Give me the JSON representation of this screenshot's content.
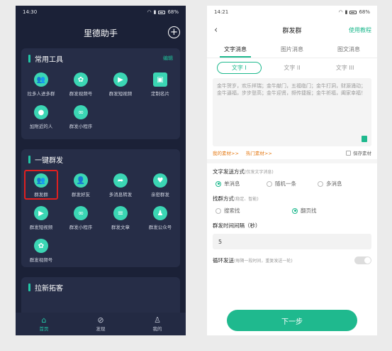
{
  "left": {
    "status_time": "14:30",
    "status_battery": "68%",
    "title": "里德助手",
    "sections": [
      {
        "title": "常用工具",
        "edit": "编辑",
        "items": [
          {
            "label": "拉多人进多群",
            "icon": "users-icon"
          },
          {
            "label": "群发视频号",
            "icon": "butterfly-icon"
          },
          {
            "label": "群发短视频",
            "icon": "video-icon"
          },
          {
            "label": "定制名片",
            "icon": "card-icon"
          },
          {
            "label": "加附近的人",
            "icon": "location-icon"
          },
          {
            "label": "群发小程序",
            "icon": "link-icon"
          }
        ]
      },
      {
        "title": "一键群发",
        "items": [
          {
            "label": "群发群",
            "icon": "group-icon"
          },
          {
            "label": "群发好友",
            "icon": "user-icon"
          },
          {
            "label": "多消息转发",
            "icon": "forward-icon"
          },
          {
            "label": "亲密群发",
            "icon": "heart-icon"
          },
          {
            "label": "群发短视频",
            "icon": "video-icon"
          },
          {
            "label": "群发小程序",
            "icon": "link-icon"
          },
          {
            "label": "群发文章",
            "icon": "article-icon"
          },
          {
            "label": "群发公众号",
            "icon": "account-icon"
          },
          {
            "label": "群发视频号",
            "icon": "butterfly-icon"
          }
        ]
      },
      {
        "title": "拉新拓客"
      }
    ],
    "tabbar": [
      {
        "label": "首页",
        "icon": "home-icon"
      },
      {
        "label": "发现",
        "icon": "compass-icon"
      },
      {
        "label": "我的",
        "icon": "profile-icon"
      }
    ]
  },
  "right": {
    "status_time": "14:21",
    "status_battery": "68%",
    "title": "群发群",
    "help": "使用教程",
    "tabs": [
      "文字消息",
      "图片消息",
      "图文消息"
    ],
    "subtabs": [
      "文字 I",
      "文字 II",
      "文字 III"
    ],
    "message": "金牛贺岁，欢乐祥瑞；金牛献门，五福临门；金牛打洞，财源涌动；金牛逼福，步步登高；金牛迎贤，频传捷报；金牛祈福，阖家幸福！",
    "my_material": "我的素材>>",
    "hot_material": "热门素材>>",
    "save_material": "保存素材",
    "send_mode_title": "文字发送方式",
    "send_mode_hint": "(仅发文字消息)",
    "send_modes": [
      "单消息",
      "随机一条",
      "多消息"
    ],
    "find_group_title": "找群方式",
    "find_group_hint": "(稳定、智能)",
    "find_modes": [
      "搜索找",
      "翻页找"
    ],
    "interval_title": "群发时间间隔（秒）",
    "interval_value": "5",
    "loop_title": "循环发送",
    "loop_hint": "(每隔一段时间，重复发送一轮)",
    "next": "下一步"
  }
}
